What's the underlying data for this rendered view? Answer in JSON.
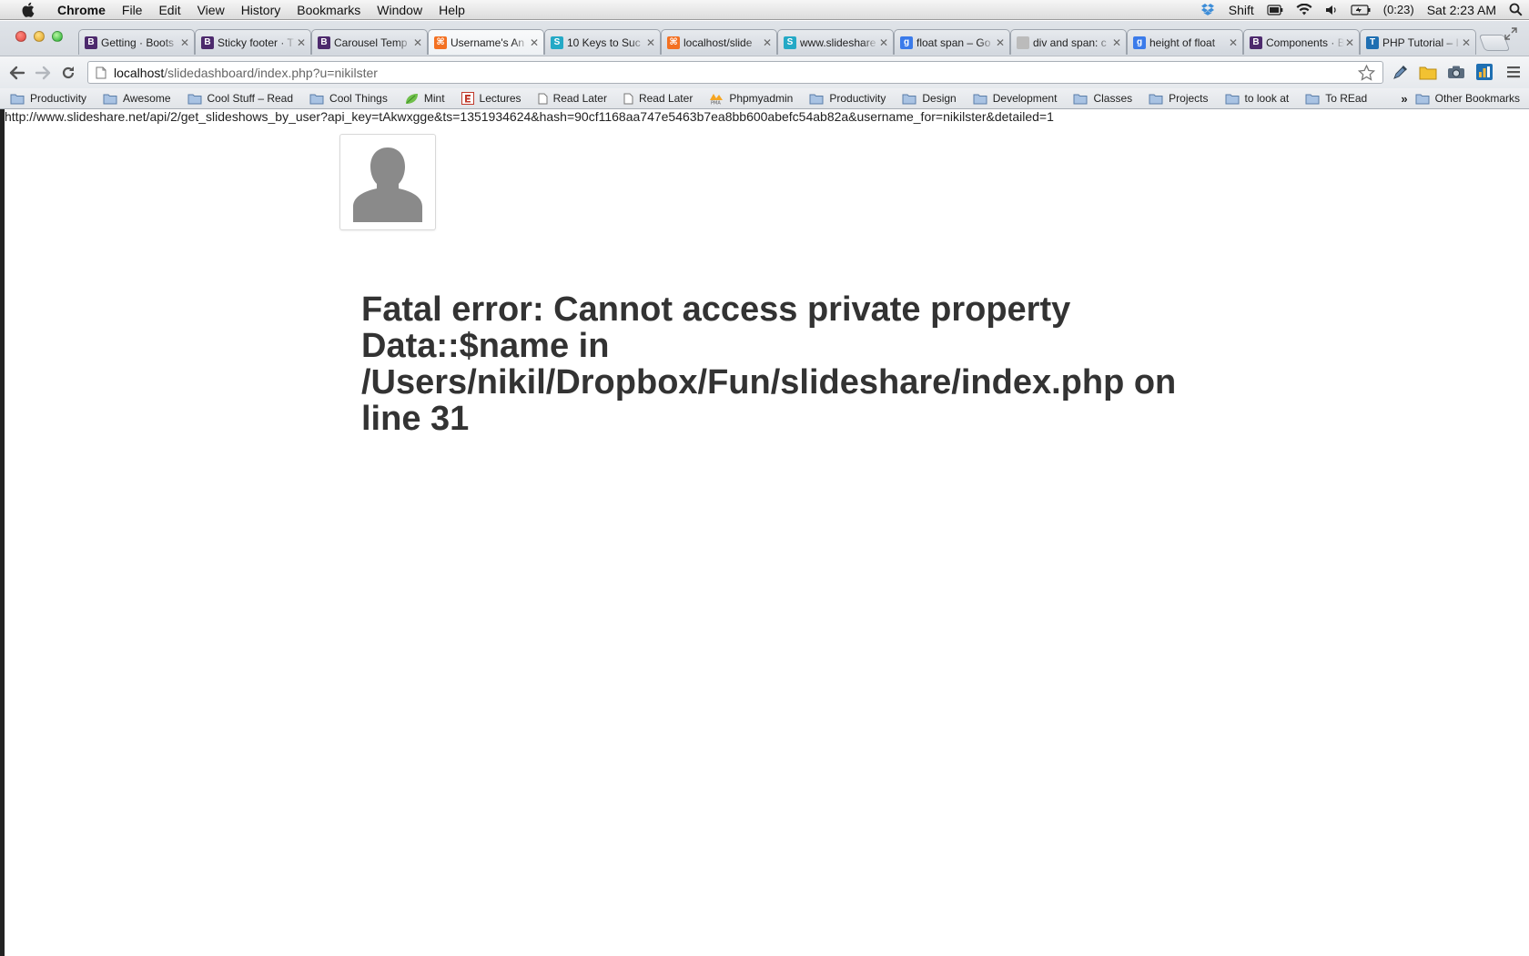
{
  "menubar": {
    "app_name": "Chrome",
    "items": [
      "File",
      "Edit",
      "View",
      "History",
      "Bookmarks",
      "Window",
      "Help"
    ],
    "status": {
      "keyboard_label": "Shift",
      "battery_time": "(0:23)",
      "clock": "Sat 2:23 AM"
    }
  },
  "tabs": [
    {
      "label": "Getting · Boots",
      "icon": "bootstrap-icon",
      "color": "#4d2a6d",
      "glyph": "B"
    },
    {
      "label": "Sticky footer · T",
      "icon": "bootstrap-icon",
      "color": "#4d2a6d",
      "glyph": "B"
    },
    {
      "label": "Carousel Temp",
      "icon": "bootstrap-icon",
      "color": "#4d2a6d",
      "glyph": "B"
    },
    {
      "label": "Username's An",
      "icon": "xampp-icon",
      "color": "#f37021",
      "glyph": "⌘",
      "active": true
    },
    {
      "label": "10 Keys to Suc",
      "icon": "slideshare-icon",
      "color": "#24a9c6",
      "glyph": "S"
    },
    {
      "label": "localhost/slide",
      "icon": "xampp-icon",
      "color": "#f37021",
      "glyph": "⌘"
    },
    {
      "label": "www.slideshare",
      "icon": "slideshare-icon",
      "color": "#24a9c6",
      "glyph": "S"
    },
    {
      "label": "float span – Go",
      "icon": "google-icon",
      "color": "#3b7bea",
      "glyph": "g"
    },
    {
      "label": "div and span: c",
      "icon": "page-icon",
      "color": "#bbbbbb",
      "glyph": ""
    },
    {
      "label": "height of float",
      "icon": "google-icon",
      "color": "#3b7bea",
      "glyph": "g"
    },
    {
      "label": "Components · B",
      "icon": "bootstrap-icon",
      "color": "#4d2a6d",
      "glyph": "B"
    },
    {
      "label": "PHP Tutorial – I",
      "icon": "php-icon",
      "color": "#1f6fb2",
      "glyph": "T"
    }
  ],
  "omnibox": {
    "host": "localhost",
    "path": "/slidedashboard/index.php?u=nikilster"
  },
  "bookmarks": [
    {
      "label": "Productivity",
      "icon": "folder-icon"
    },
    {
      "label": "Awesome",
      "icon": "folder-icon"
    },
    {
      "label": "Cool Stuff – Read",
      "icon": "folder-icon"
    },
    {
      "label": "Cool Things",
      "icon": "folder-icon"
    },
    {
      "label": "Mint",
      "icon": "mint-leaf-icon"
    },
    {
      "label": "Lectures",
      "icon": "lectures-icon"
    },
    {
      "label": "Read Later",
      "icon": "page-icon"
    },
    {
      "label": "Read Later",
      "icon": "page-icon"
    },
    {
      "label": "Phpmyadmin",
      "icon": "phpmyadmin-icon"
    },
    {
      "label": "Productivity",
      "icon": "folder-icon"
    },
    {
      "label": "Design",
      "icon": "folder-icon"
    },
    {
      "label": "Development",
      "icon": "folder-icon"
    },
    {
      "label": "Classes",
      "icon": "folder-icon"
    },
    {
      "label": "Projects",
      "icon": "folder-icon"
    },
    {
      "label": "to look at",
      "icon": "folder-icon"
    },
    {
      "label": "To REad",
      "icon": "folder-icon"
    }
  ],
  "bookmarks_overflow": "»",
  "other_bookmarks": "Other Bookmarks",
  "page": {
    "debug_url": "http://www.slideshare.net/api/2/get_slideshows_by_user?api_key=tAkwxgge&ts=1351934624&hash=90cf1168aa747e5463b7ea8bb600abefc54ab82a&username_for=nikilster&detailed=1",
    "error_message": "Fatal error: Cannot access private property Data::$name in /Users/nikil/Dropbox/Fun/slideshare/index.php on line 31"
  },
  "colors": {
    "error_text": "#333333",
    "folder": "#8fb1d9"
  }
}
